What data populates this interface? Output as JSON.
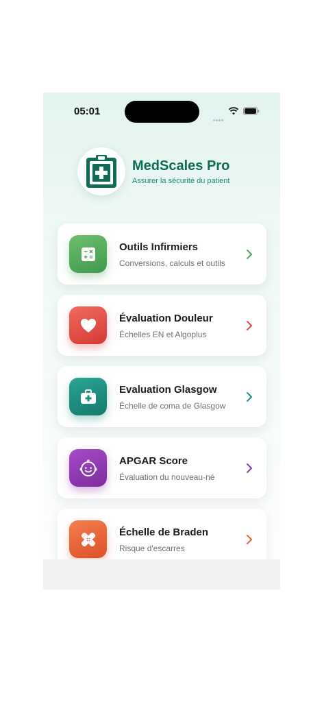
{
  "status_bar": {
    "time": "05:01"
  },
  "header": {
    "title": "MedScales Pro",
    "subtitle": "Assurer la sécurité du patient",
    "logo_icon": "clipboard-plus-icon"
  },
  "colors": {
    "brand": "#0f6d57",
    "green": "#4ea35a",
    "red": "#e24c45",
    "teal": "#1a8f80",
    "purple": "#8e35b0",
    "orange": "#ea6535"
  },
  "cards": [
    {
      "title": "Outils Infirmiers",
      "description": "Conversions, calculs et outils",
      "icon": "calculator-icon"
    },
    {
      "title": "Évaluation Douleur",
      "description": "Échelles EN et Algoplus",
      "icon": "heart-icon"
    },
    {
      "title": "Evaluation Glasgow",
      "description": "Échelle de coma de Glasgow",
      "icon": "medical-kit-icon"
    },
    {
      "title": "APGAR Score",
      "description": "Évaluation du nouveau-né",
      "icon": "baby-face-icon"
    },
    {
      "title": "Échelle de Braden",
      "description": "Risque d'escarres",
      "icon": "bandage-icon"
    }
  ]
}
